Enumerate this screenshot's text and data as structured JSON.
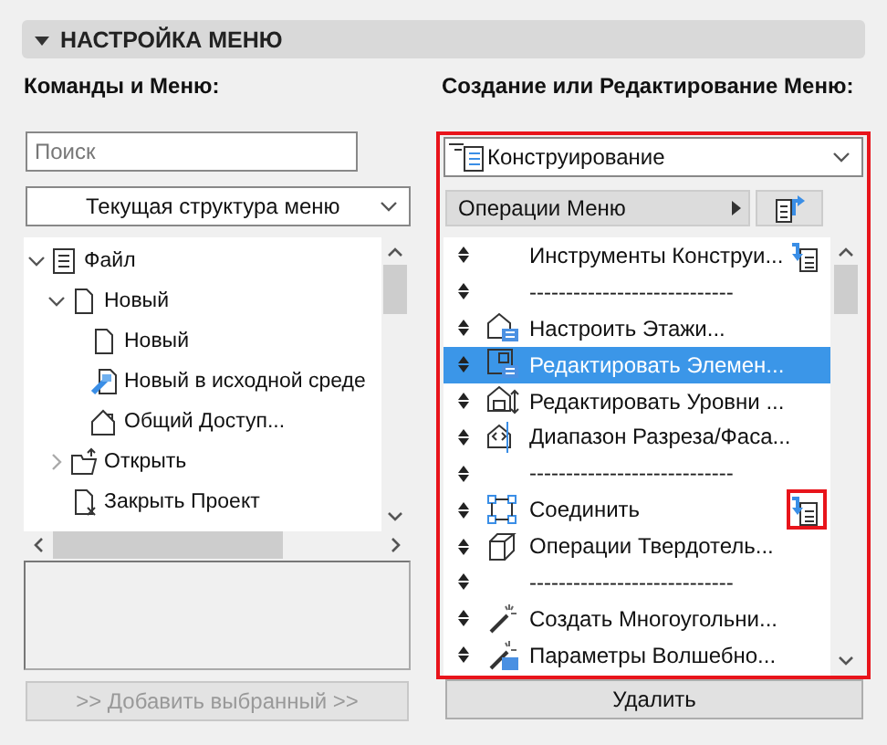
{
  "section": {
    "title": "НАСТРОЙКА МЕНЮ",
    "expanded": true
  },
  "left": {
    "label": "Команды и Меню:",
    "search": {
      "placeholder": "Поиск"
    },
    "structure": {
      "value": "Текущая структура меню"
    },
    "tree": [
      {
        "label": "Файл",
        "expanded": true,
        "children": [
          {
            "label": "Новый",
            "expanded": true,
            "children": [
              {
                "label": "Новый"
              },
              {
                "label": "Новый в исходной среде"
              },
              {
                "label": "Общий Доступ..."
              }
            ]
          },
          {
            "label": "Открыть",
            "expanded": false
          },
          {
            "label": "Закрыть Проект"
          }
        ]
      }
    ],
    "add_button": {
      "label": ">> Добавить выбранный >>",
      "disabled": true
    }
  },
  "right": {
    "label": "Создание или Редактирование Меню:",
    "highlighted": true,
    "menu": {
      "value": "Конструирование"
    },
    "operations": {
      "label": "Операции Меню"
    },
    "items": [
      {
        "kind": "command",
        "label": "Инструменты Конструи...",
        "selected": false,
        "action": true,
        "action_highlighted": false
      },
      {
        "kind": "separator",
        "label": "----------------------------",
        "selected": false
      },
      {
        "kind": "command",
        "label": "Настроить Этажи...",
        "selected": false
      },
      {
        "kind": "command",
        "label": "Редактировать Элемен...",
        "selected": true
      },
      {
        "kind": "command",
        "label": "Редактировать Уровни ...",
        "selected": false
      },
      {
        "kind": "command",
        "label": "Диапазон Разреза/Фаса...",
        "selected": false
      },
      {
        "kind": "separator",
        "label": "----------------------------",
        "selected": false
      },
      {
        "kind": "command",
        "label": "Соединить",
        "selected": false,
        "action": true,
        "action_highlighted": true
      },
      {
        "kind": "command",
        "label": "Операции Твердотель...",
        "selected": false
      },
      {
        "kind": "separator",
        "label": "----------------------------",
        "selected": false
      },
      {
        "kind": "command",
        "label": "Создать Многоугольни...",
        "selected": false
      },
      {
        "kind": "command",
        "label": "Параметры Волшебно...",
        "selected": false
      }
    ],
    "delete_button": {
      "label": "Удалить"
    }
  }
}
